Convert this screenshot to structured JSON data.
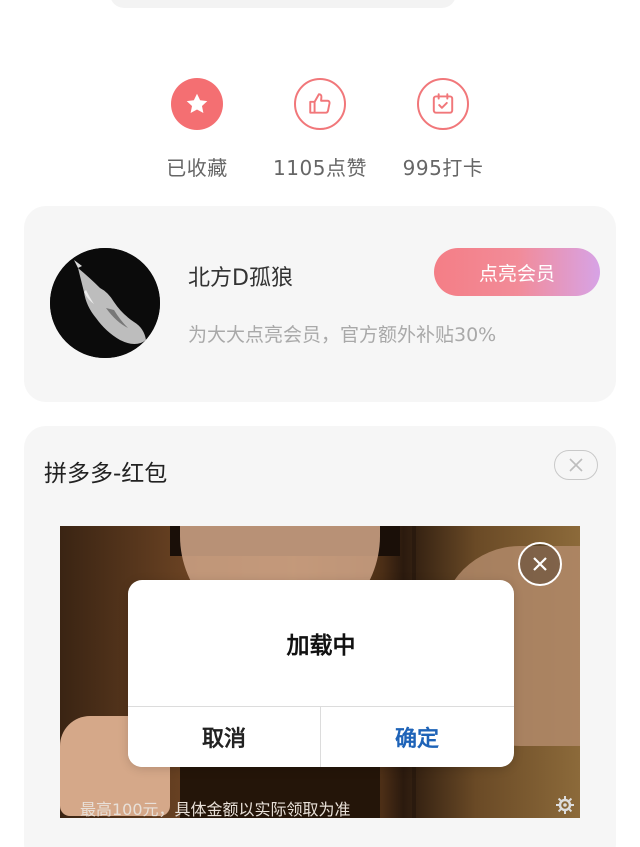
{
  "stats": [
    {
      "icon": "star-icon",
      "label": "已收藏"
    },
    {
      "icon": "thumbs-up-icon",
      "label": "1105点赞"
    },
    {
      "icon": "calendar-check-icon",
      "label": "995打卡"
    }
  ],
  "member": {
    "username": "北方D孤狼",
    "description": "为大大点亮会员，官方额外补贴30%",
    "button_label": "点亮会员"
  },
  "ad": {
    "title": "拼多多-红包",
    "caption": "最高100元，具体金额以实际领取为准"
  },
  "dialog": {
    "message": "加载中",
    "cancel_label": "取消",
    "confirm_label": "确定"
  },
  "colors": {
    "accent": "#f46f72",
    "confirm_blue": "#1e63b8"
  }
}
